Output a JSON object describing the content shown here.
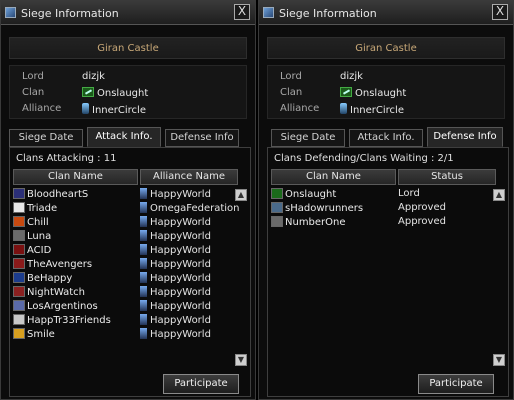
{
  "left_window": {
    "title": "Siege Information",
    "close_label": "X",
    "castle": "Giran Castle",
    "info": [
      {
        "label": "Lord",
        "value": "dizjk"
      },
      {
        "label": "Clan",
        "value": "Onslaught"
      },
      {
        "label": "Alliance",
        "value": "InnerCircle"
      }
    ],
    "tabs": [
      "Siege Date",
      "Attack Info.",
      "Defense Info"
    ],
    "active_tab": "Attack Info.",
    "caption": "Clans Attacking : 11",
    "columns": [
      "Clan Name",
      "Alliance Name"
    ],
    "rows": [
      {
        "clan": "BloodheartS",
        "alliance": "HappyWorld"
      },
      {
        "clan": "Triade",
        "alliance": "OmegaFederation"
      },
      {
        "clan": "Chill",
        "alliance": "HappyWorld"
      },
      {
        "clan": "Luna",
        "alliance": "HappyWorld"
      },
      {
        "clan": "ACID",
        "alliance": "HappyWorld"
      },
      {
        "clan": "TheAvengers",
        "alliance": "HappyWorld"
      },
      {
        "clan": "BeHappy",
        "alliance": "HappyWorld"
      },
      {
        "clan": "NightWatch",
        "alliance": "HappyWorld"
      },
      {
        "clan": "LosArgentinos",
        "alliance": "HappyWorld"
      },
      {
        "clan": "HappTr33Friends",
        "alliance": "HappyWorld"
      },
      {
        "clan": "Smile",
        "alliance": "HappyWorld"
      }
    ],
    "button": "Participate"
  },
  "right_window": {
    "title": "Siege Information",
    "close_label": "X",
    "castle": "Giran Castle",
    "info": [
      {
        "label": "Lord",
        "value": "dizjk"
      },
      {
        "label": "Clan",
        "value": "Onslaught"
      },
      {
        "label": "Alliance",
        "value": "InnerCircle"
      }
    ],
    "tabs": [
      "Siege Date",
      "Attack Info.",
      "Defense Info"
    ],
    "active_tab": "Defense Info",
    "caption": "Clans Defending/Clans Waiting : 2/1",
    "columns": [
      "Clan Name",
      "Status"
    ],
    "rows": [
      {
        "clan": "Onslaught",
        "status": "Lord"
      },
      {
        "clan": "sHadowrunners",
        "status": "Approved"
      },
      {
        "clan": "NumberOne",
        "status": "Approved"
      }
    ],
    "button": "Participate"
  },
  "icons": {
    "title": "window-icon",
    "close": "close-icon",
    "scroll_up": "scroll-up-arrow-icon",
    "scroll_down": "scroll-down-arrow-icon"
  },
  "colors": {
    "castle_text": "#c8a878",
    "crests": [
      "#2b2f78",
      "#e8e8e8",
      "#c84a10",
      "#6a6a6a",
      "#7a1010",
      "#8a1a1a",
      "#1c3c8c",
      "#8a2020",
      "#5a6aa8",
      "#c8c8c8",
      "#d8a020"
    ],
    "defender_crests": [
      "#1a6a1a",
      "#4a6a8a",
      "#6a6a6a"
    ]
  }
}
